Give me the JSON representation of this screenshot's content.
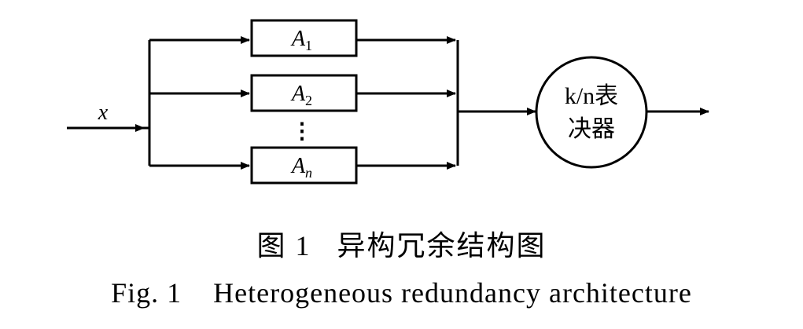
{
  "diagram": {
    "input_label": "x",
    "blocks": [
      {
        "symbol": "A",
        "subscript": "1"
      },
      {
        "symbol": "A",
        "subscript": "2"
      },
      {
        "symbol": "A",
        "subscript": "n"
      }
    ],
    "ellipsis": "⋮",
    "voter_line1": "k/n表",
    "voter_line2": "决器"
  },
  "caption": {
    "cn": "图 1   异构冗余结构图",
    "en": "Fig. 1    Heterogeneous redundancy architecture"
  }
}
